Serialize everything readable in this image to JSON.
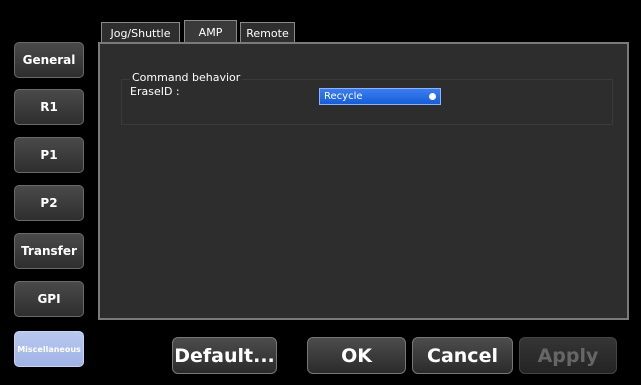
{
  "sidebar": {
    "items": [
      {
        "label": "General"
      },
      {
        "label": "R1"
      },
      {
        "label": "P1"
      },
      {
        "label": "P2"
      },
      {
        "label": "Transfer"
      },
      {
        "label": "GPI"
      },
      {
        "label": "Miscellaneous"
      }
    ],
    "active": "Miscellaneous"
  },
  "tabs": [
    {
      "label": "Jog/Shuttle"
    },
    {
      "label": "AMP"
    },
    {
      "label": "Remote"
    }
  ],
  "active_tab": "AMP",
  "group": {
    "title": "Command behavior",
    "field_label": "EraseID :",
    "select_value": "Recycle"
  },
  "buttons": {
    "default": "Default...",
    "ok": "OK",
    "cancel": "Cancel",
    "apply": "Apply"
  },
  "colors": {
    "active_sidebar": "#a9bbea",
    "select_blue": "#1f66e0"
  }
}
